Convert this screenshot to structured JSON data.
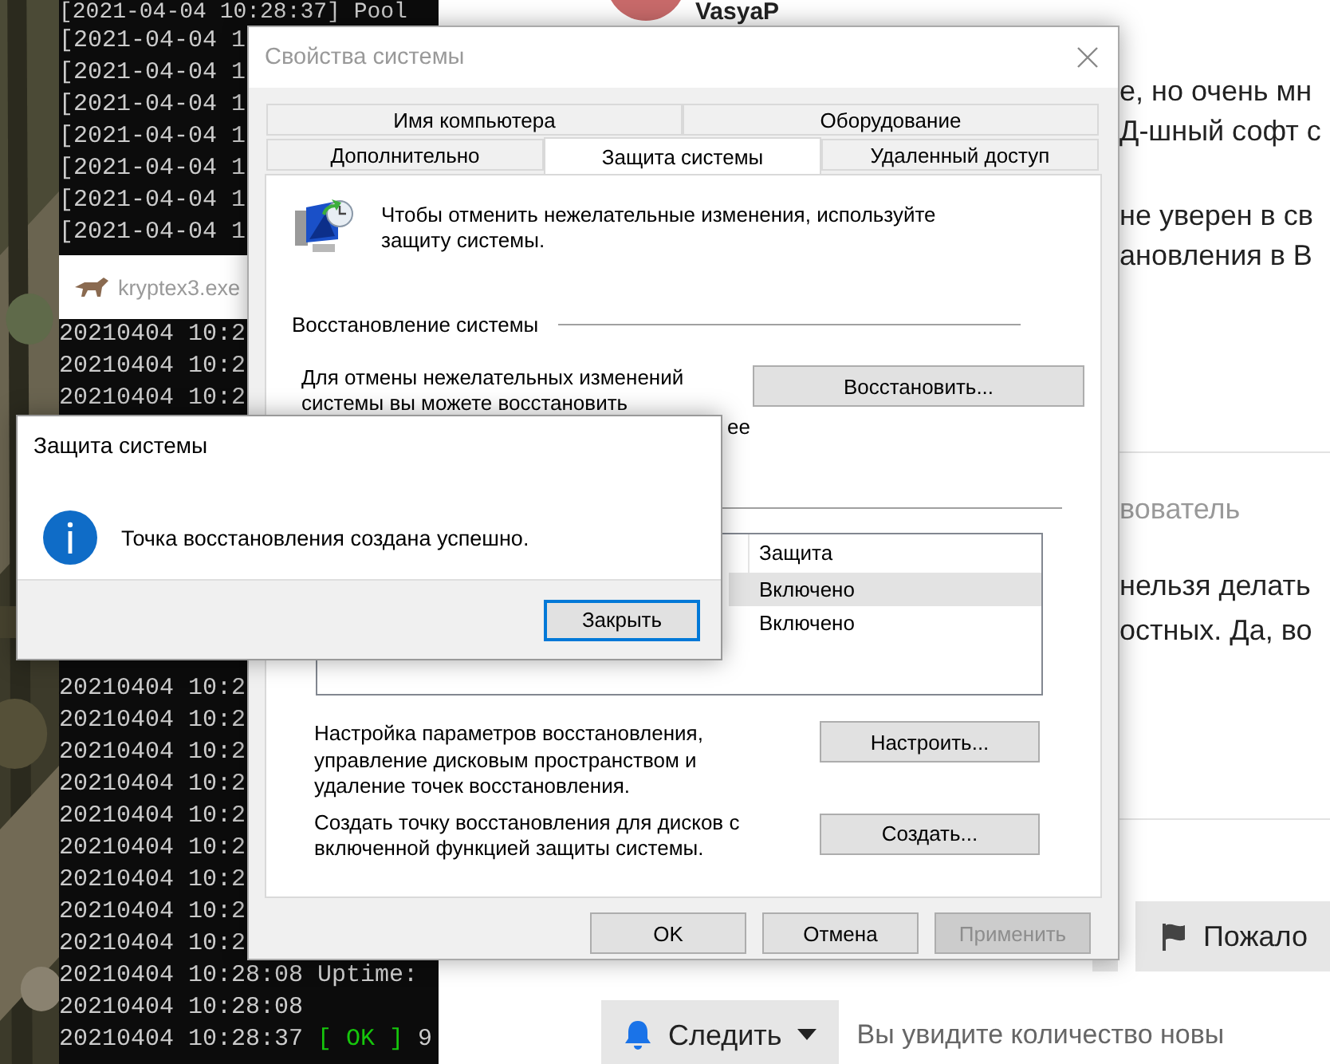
{
  "terminals": [
    {
      "lines": [
        {
          "text": "[2021-04-04 10:28:37] Pool"
        },
        {
          "text": "[2021-04-04 1"
        },
        {
          "text": "[2021-04-04 1"
        },
        {
          "text": "[2021-04-04 1"
        },
        {
          "text": "[2021-04-04 1"
        },
        {
          "text": "[2021-04-04 1"
        },
        {
          "text": "[2021-04-04 1"
        },
        {
          "text": "[2021-04-04 1"
        }
      ]
    },
    {
      "title": "kryptex3.exe",
      "blocks": [
        [
          {
            "text": "20210404 10:2"
          },
          {
            "text": "20210404 10:2"
          },
          {
            "text": "20210404 10:2"
          }
        ],
        [
          {
            "text": "20210404 10:2"
          },
          {
            "text": "20210404 10:2"
          },
          {
            "text": "20210404 10:2"
          },
          {
            "text": "20210404 10:2"
          },
          {
            "text": "20210404 10:2"
          },
          {
            "text": "20210404 10:2"
          },
          {
            "text": "20210404 10:2"
          },
          {
            "text": "20210404 10:2"
          },
          {
            "text": "20210404 10:2"
          },
          {
            "text": "20210404 10:28:08 Uptime:"
          },
          {
            "text": "20210404 10:28:08"
          },
          {
            "text": "20210404 10:28:37",
            "status": "[ OK ]",
            "rest": "9"
          }
        ]
      ]
    }
  ],
  "web": {
    "author": "VasyaP",
    "paragraphs": [
      [
        "е, но очень мн",
        "Д-шный софт с"
      ],
      [
        "не уверен в св",
        "ановления в В"
      ]
    ],
    "role": "вователь",
    "reply": [
      "нельзя делать",
      "остных. Да, во"
    ],
    "report_button": "Пожало",
    "follow_button": "Следить",
    "follow_hint": "Вы увидите количество новы"
  },
  "dialog": {
    "title": "Свойства системы",
    "tab_rows": [
      [
        {
          "label": "Имя компьютера",
          "selected": false
        },
        {
          "label": "Оборудование",
          "selected": false
        }
      ],
      [
        {
          "label": "Дополнительно",
          "selected": false
        },
        {
          "label": "Защита системы",
          "selected": true
        },
        {
          "label": "Удаленный доступ",
          "selected": false
        }
      ]
    ],
    "intro": "Чтобы отменить нежелательные изменения, используйте защиту системы.",
    "restore": {
      "heading": "Восстановление системы",
      "text": "Для отмены нежелательных изменений системы вы можете восстановить",
      "text_fragment": "ее",
      "button": "Восстановить..."
    },
    "table": {
      "columns": [
        "Защита"
      ],
      "rows": [
        {
          "cells": [
            "Включено"
          ],
          "selected": true
        },
        {
          "cells": [
            "Включено"
          ],
          "selected": false
        }
      ]
    },
    "actions": [
      {
        "text": "Настройка параметров восстановления, управление дисковым пространством и удаление точек восстановления.",
        "button": "Настроить..."
      },
      {
        "text": "Создать точку восстановления для дисков с включенной функцией защиты системы.",
        "button": "Создать..."
      }
    ],
    "buttons": [
      {
        "label": "OK",
        "disabled": false
      },
      {
        "label": "Отмена",
        "disabled": false
      },
      {
        "label": "Применить",
        "disabled": true
      }
    ]
  },
  "message_box": {
    "title": "Защита системы",
    "message": "Точка восстановления создана успешно.",
    "button": {
      "label": "Закрыть",
      "focused": true
    }
  }
}
